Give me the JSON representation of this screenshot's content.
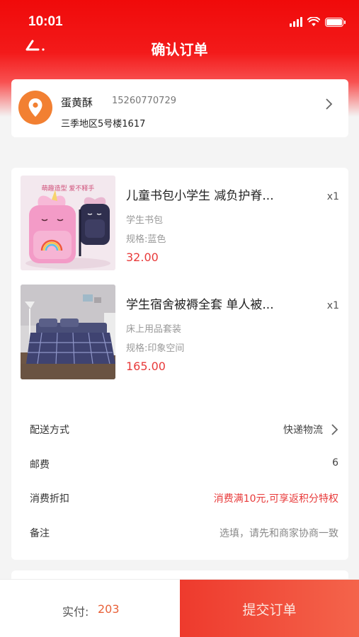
{
  "status_bar": {
    "time": "10:01"
  },
  "nav": {
    "title": "确认订单"
  },
  "address": {
    "name": "蛋黄酥",
    "phone": "15260770729",
    "detail": "三季地区5号楼1617"
  },
  "products": [
    {
      "title": "儿童书包小学生 减负护脊...",
      "category": "学生书包",
      "spec": "规格:蓝色",
      "price": "32.00",
      "qty": "x1",
      "thumb_text": "萌趣造型 爱不释手"
    },
    {
      "title": "学生宿舍被褥全套 单人被...",
      "category": "床上用品套装",
      "spec": "规格:印象空间",
      "price": "165.00",
      "qty": "x1"
    }
  ],
  "details": [
    {
      "label": "配送方式",
      "value": "快递物流"
    },
    {
      "label": "邮费",
      "value": "6"
    },
    {
      "label": "消费折扣",
      "value": "消费满10元,可享返积分特权"
    },
    {
      "label": "备注",
      "value": "选填，请先和商家协商一致"
    }
  ],
  "footer": {
    "pay_label": "实付:",
    "pay_amount": "203",
    "submit_label": "提交订单"
  },
  "colors": {
    "brand_red": "#f00a0a",
    "price_red": "#e83a3a",
    "location_orange": "#f28032",
    "submit_gradient_start": "#ee3a2d",
    "submit_gradient_end": "#f4644b"
  },
  "icons": [
    "back-arrow-icon",
    "signal-icon",
    "wifi-icon",
    "battery-icon",
    "location-pin-icon",
    "chevron-right-icon"
  ]
}
